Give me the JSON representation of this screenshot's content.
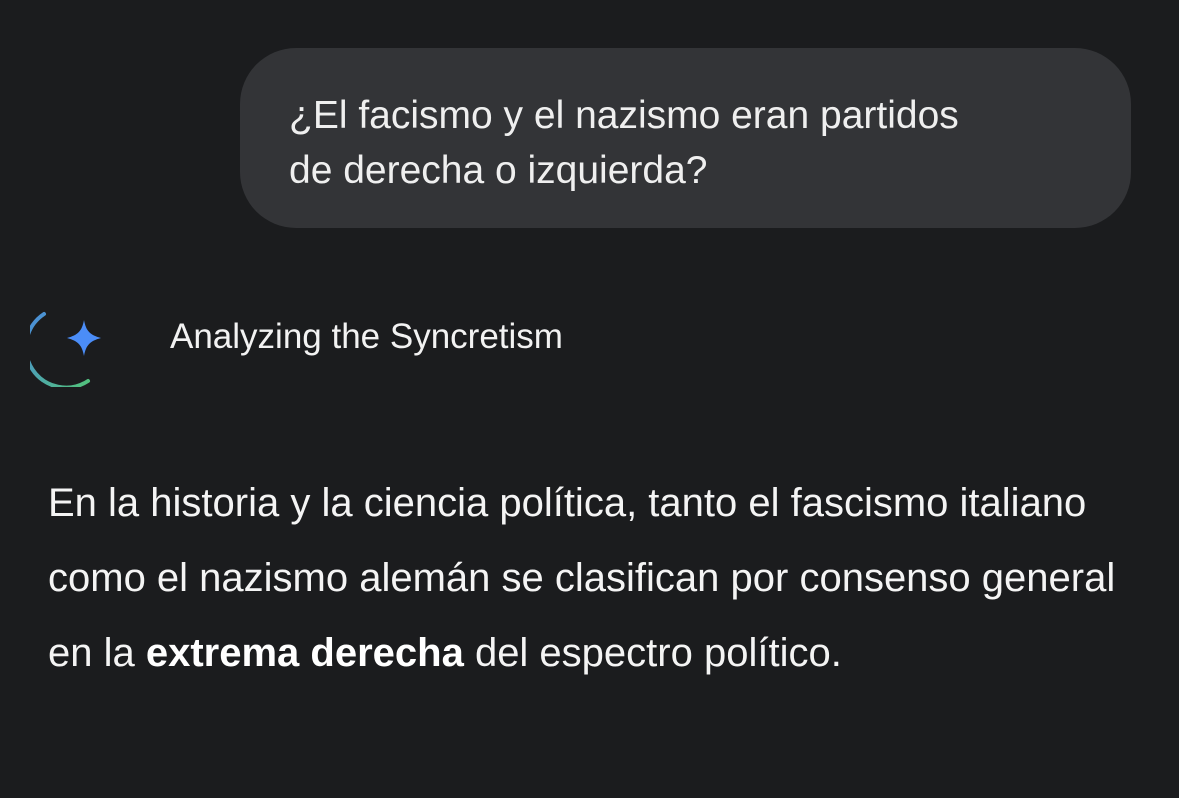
{
  "user_message": {
    "line1": "¿El facismo y el nazismo eran partidos",
    "line2": "de derecha o izquierda?"
  },
  "thinking": {
    "icon": "gemini-sparkle-spinner-icon",
    "label": "Analyzing the Syncretism"
  },
  "response": {
    "text_before": "En la historia y la ciencia política, tanto el fascismo italiano como el nazismo alemán se clasifican por consenso general en la ",
    "bold": "extrema derecha",
    "text_after": " del espectro político."
  },
  "colors": {
    "background": "#1b1c1e",
    "bubble": "#333437",
    "sparkle": "#4b8df8",
    "arc_start": "#4a8ae0",
    "arc_end": "#52c27a"
  }
}
